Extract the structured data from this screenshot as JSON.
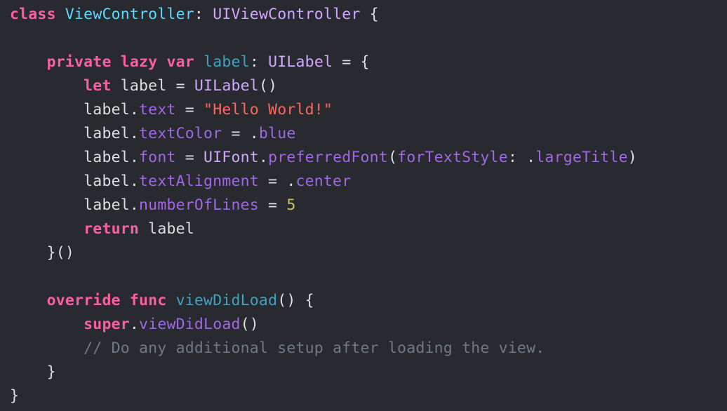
{
  "colors": {
    "background": "#292a30",
    "plain": "#dfdfe0",
    "keyword": "#fc5fa3",
    "type_declaration": "#5dd8ff",
    "project_type": "#d0a8ff",
    "property_declaration": "#41a1c0",
    "member": "#a167e6",
    "string": "#fc6a5d",
    "number": "#d0bf69",
    "comment": "#6c7986"
  },
  "code": {
    "lines": [
      [
        {
          "t": "class",
          "k": "kw"
        },
        {
          "t": " ",
          "k": "plain"
        },
        {
          "t": "ViewController",
          "k": "type-decl"
        },
        {
          "t": ": ",
          "k": "plain"
        },
        {
          "t": "UIViewController",
          "k": "type-proj"
        },
        {
          "t": " {",
          "k": "plain"
        }
      ],
      [],
      [
        {
          "t": "    ",
          "k": "plain"
        },
        {
          "t": "private",
          "k": "kw"
        },
        {
          "t": " ",
          "k": "plain"
        },
        {
          "t": "lazy",
          "k": "kw"
        },
        {
          "t": " ",
          "k": "plain"
        },
        {
          "t": "var",
          "k": "kw"
        },
        {
          "t": " ",
          "k": "plain"
        },
        {
          "t": "label",
          "k": "prop-decl"
        },
        {
          "t": ": ",
          "k": "plain"
        },
        {
          "t": "UILabel",
          "k": "type-proj"
        },
        {
          "t": " = {",
          "k": "plain"
        }
      ],
      [
        {
          "t": "        ",
          "k": "plain"
        },
        {
          "t": "let",
          "k": "kw"
        },
        {
          "t": " label = ",
          "k": "plain"
        },
        {
          "t": "UILabel",
          "k": "type-proj"
        },
        {
          "t": "()",
          "k": "plain"
        }
      ],
      [
        {
          "t": "        label.",
          "k": "plain"
        },
        {
          "t": "text",
          "k": "member"
        },
        {
          "t": " = ",
          "k": "plain"
        },
        {
          "t": "\"Hello World!\"",
          "k": "str"
        }
      ],
      [
        {
          "t": "        label.",
          "k": "plain"
        },
        {
          "t": "textColor",
          "k": "member"
        },
        {
          "t": " = .",
          "k": "plain"
        },
        {
          "t": "blue",
          "k": "member"
        }
      ],
      [
        {
          "t": "        label.",
          "k": "plain"
        },
        {
          "t": "font",
          "k": "member"
        },
        {
          "t": " = ",
          "k": "plain"
        },
        {
          "t": "UIFont",
          "k": "type-proj"
        },
        {
          "t": ".",
          "k": "plain"
        },
        {
          "t": "preferredFont",
          "k": "member"
        },
        {
          "t": "(",
          "k": "plain"
        },
        {
          "t": "forTextStyle",
          "k": "member"
        },
        {
          "t": ": .",
          "k": "plain"
        },
        {
          "t": "largeTitle",
          "k": "member"
        },
        {
          "t": ")",
          "k": "plain"
        }
      ],
      [
        {
          "t": "        label.",
          "k": "plain"
        },
        {
          "t": "textAlignment",
          "k": "member"
        },
        {
          "t": " = .",
          "k": "plain"
        },
        {
          "t": "center",
          "k": "member"
        }
      ],
      [
        {
          "t": "        label.",
          "k": "plain"
        },
        {
          "t": "numberOfLines",
          "k": "member"
        },
        {
          "t": " = ",
          "k": "plain"
        },
        {
          "t": "5",
          "k": "num"
        }
      ],
      [
        {
          "t": "        ",
          "k": "plain"
        },
        {
          "t": "return",
          "k": "kw"
        },
        {
          "t": " label",
          "k": "plain"
        }
      ],
      [
        {
          "t": "    }()",
          "k": "plain"
        }
      ],
      [],
      [
        {
          "t": "    ",
          "k": "plain"
        },
        {
          "t": "override",
          "k": "kw"
        },
        {
          "t": " ",
          "k": "plain"
        },
        {
          "t": "func",
          "k": "kw"
        },
        {
          "t": " ",
          "k": "plain"
        },
        {
          "t": "viewDidLoad",
          "k": "prop-decl"
        },
        {
          "t": "() {",
          "k": "plain"
        }
      ],
      [
        {
          "t": "        ",
          "k": "plain"
        },
        {
          "t": "super",
          "k": "kw"
        },
        {
          "t": ".",
          "k": "plain"
        },
        {
          "t": "viewDidLoad",
          "k": "member"
        },
        {
          "t": "()",
          "k": "plain"
        }
      ],
      [
        {
          "t": "        ",
          "k": "plain"
        },
        {
          "t": "// Do any additional setup after loading the view.",
          "k": "cmt"
        }
      ],
      [
        {
          "t": "    }",
          "k": "plain"
        }
      ],
      [
        {
          "t": "}",
          "k": "plain"
        }
      ]
    ]
  }
}
